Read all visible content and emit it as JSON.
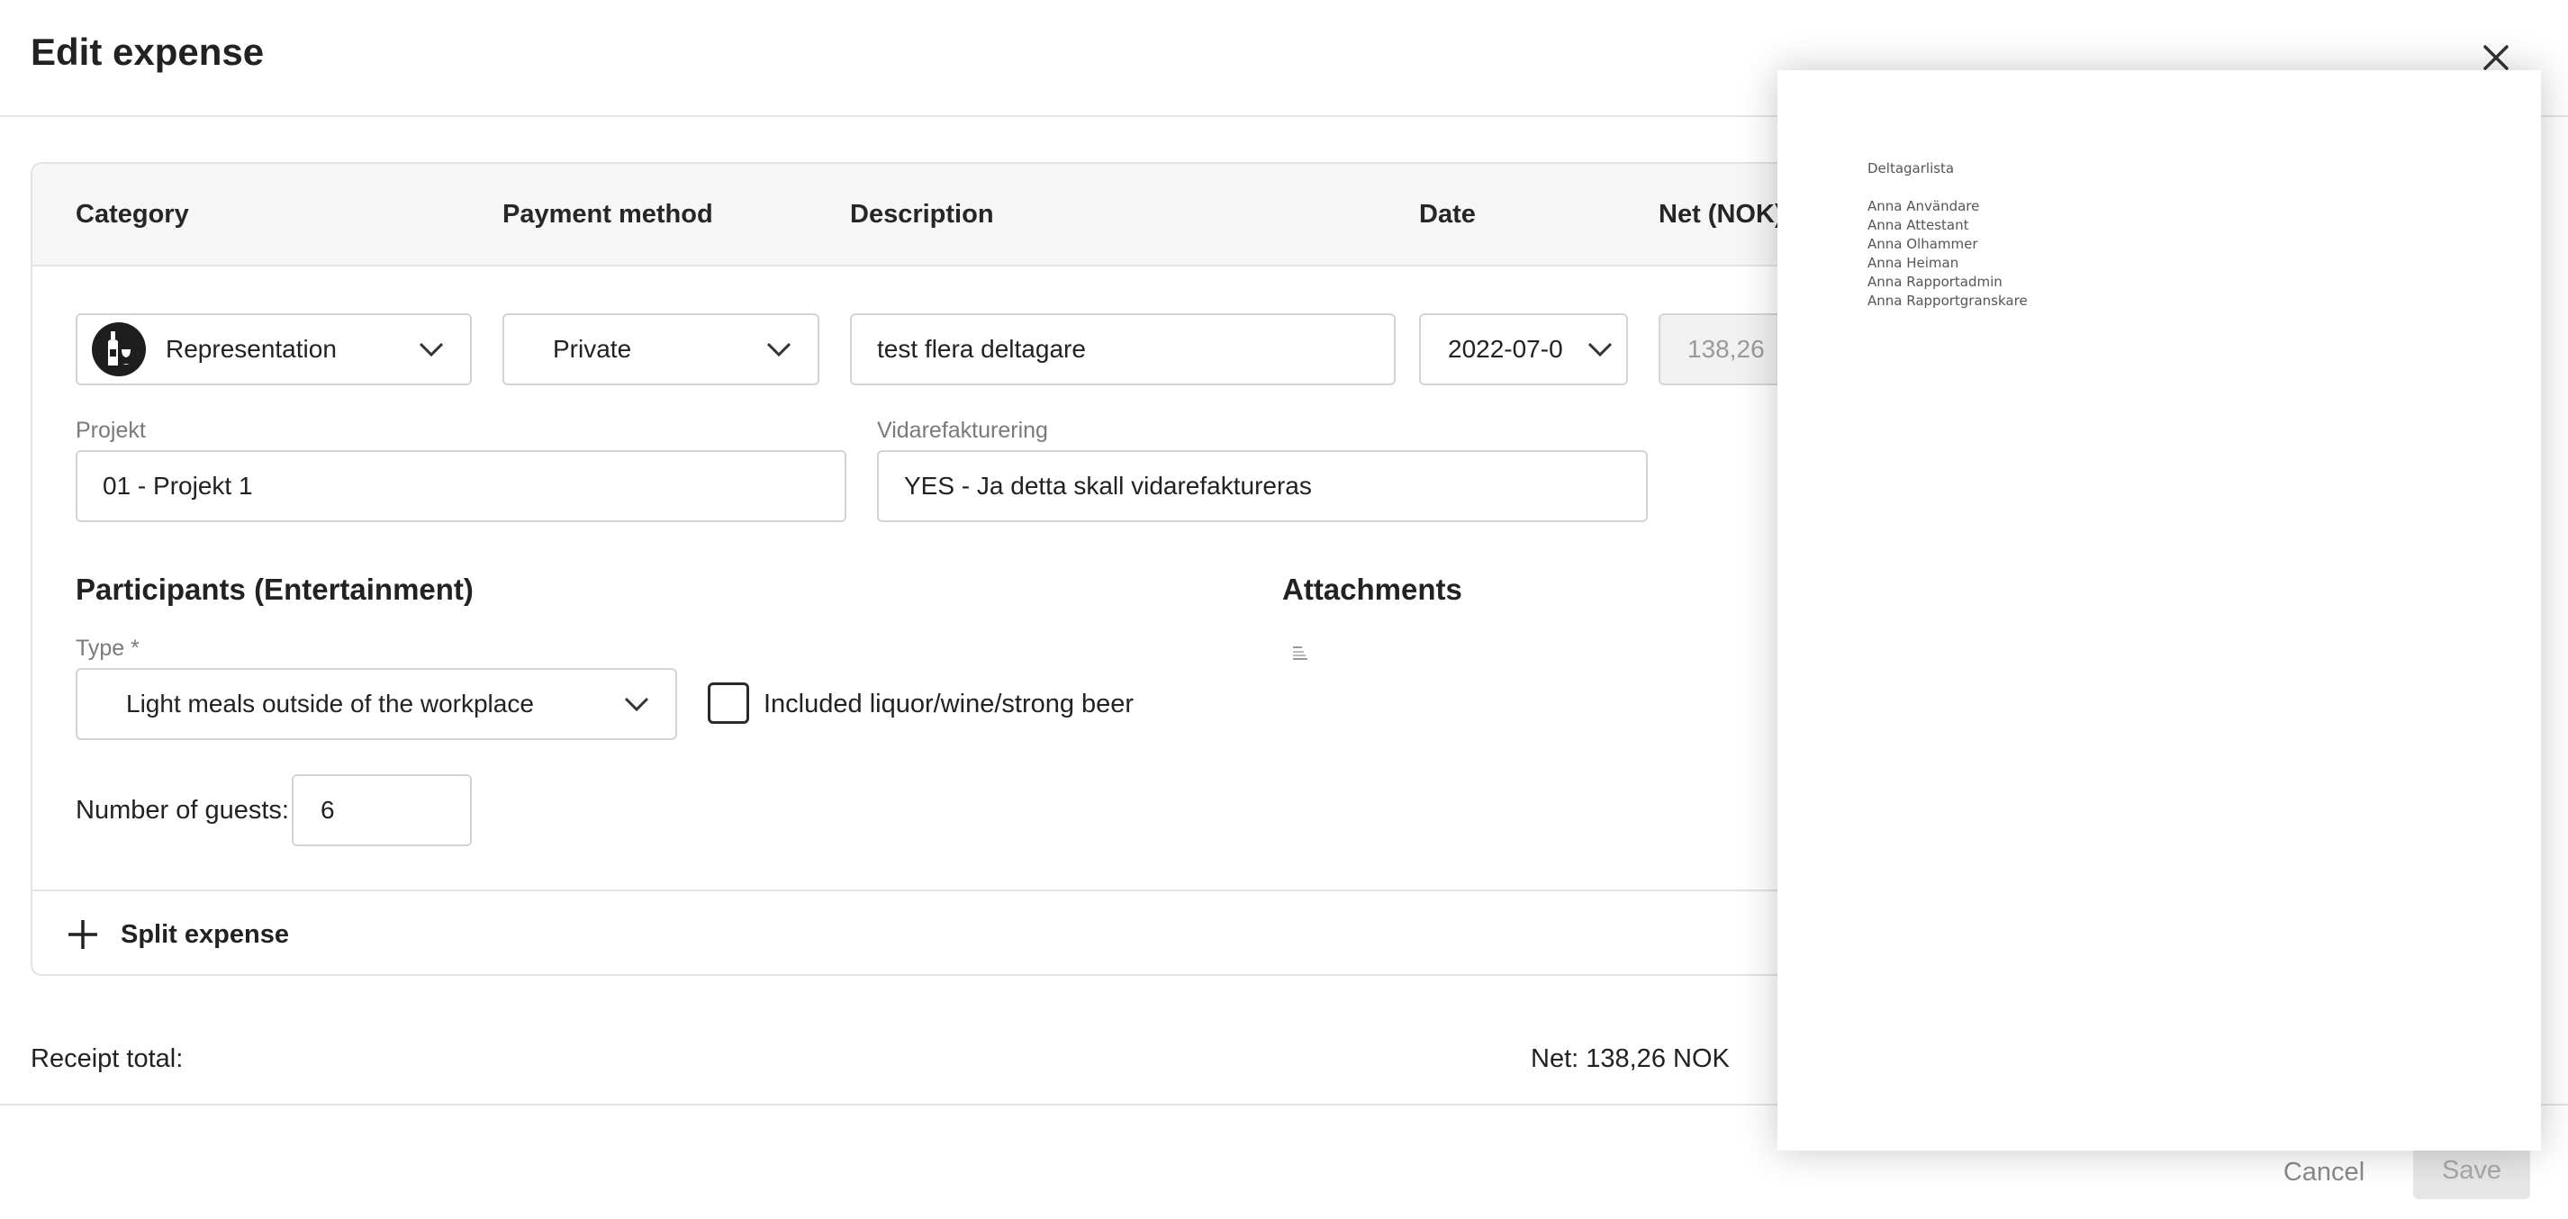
{
  "dialog": {
    "title": "Edit expense"
  },
  "table": {
    "headers": {
      "category": "Category",
      "payment_method": "Payment method",
      "description": "Description",
      "date": "Date",
      "net": "Net (NOK)"
    }
  },
  "row": {
    "category": {
      "value": "Representation",
      "icon": "wine-bottle-glass-icon"
    },
    "payment_method": "Private",
    "description": "test flera deltagare",
    "date": "2022-07-0",
    "net": "138,26"
  },
  "projekt": {
    "label": "Projekt",
    "value": "01 - Projekt 1"
  },
  "vidarefakturering": {
    "label": "Vidarefakturering",
    "value": "YES - Ja detta skall vidarefaktureras"
  },
  "participants": {
    "title": "Participants (Entertainment)",
    "type_label": "Type *",
    "type_value": "Light meals outside of the workplace",
    "checkbox_label": "Included liquor/wine/strong beer",
    "checkbox_checked": false,
    "guests_label": "Number of guests:",
    "guests_value": "6"
  },
  "attachments": {
    "title": "Attachments",
    "icon": "document-thumbnail-icon"
  },
  "split": {
    "label": "Split expense"
  },
  "totals": {
    "label": "Receipt total:",
    "net": "Net: 138,26 NOK"
  },
  "preview": {
    "heading": "Deltagarlista",
    "names": [
      "Anna Användare",
      "Anna Attestant",
      "Anna Olhammer",
      "Anna Heiman",
      "Anna Rapportadmin",
      "Anna Rapportgranskare"
    ]
  },
  "footer": {
    "cancel": "Cancel",
    "save": "Save"
  },
  "colors": {
    "border": "#d4d4d4",
    "header_bg": "#f6f6f6",
    "disabled": "#e6e6e6"
  }
}
